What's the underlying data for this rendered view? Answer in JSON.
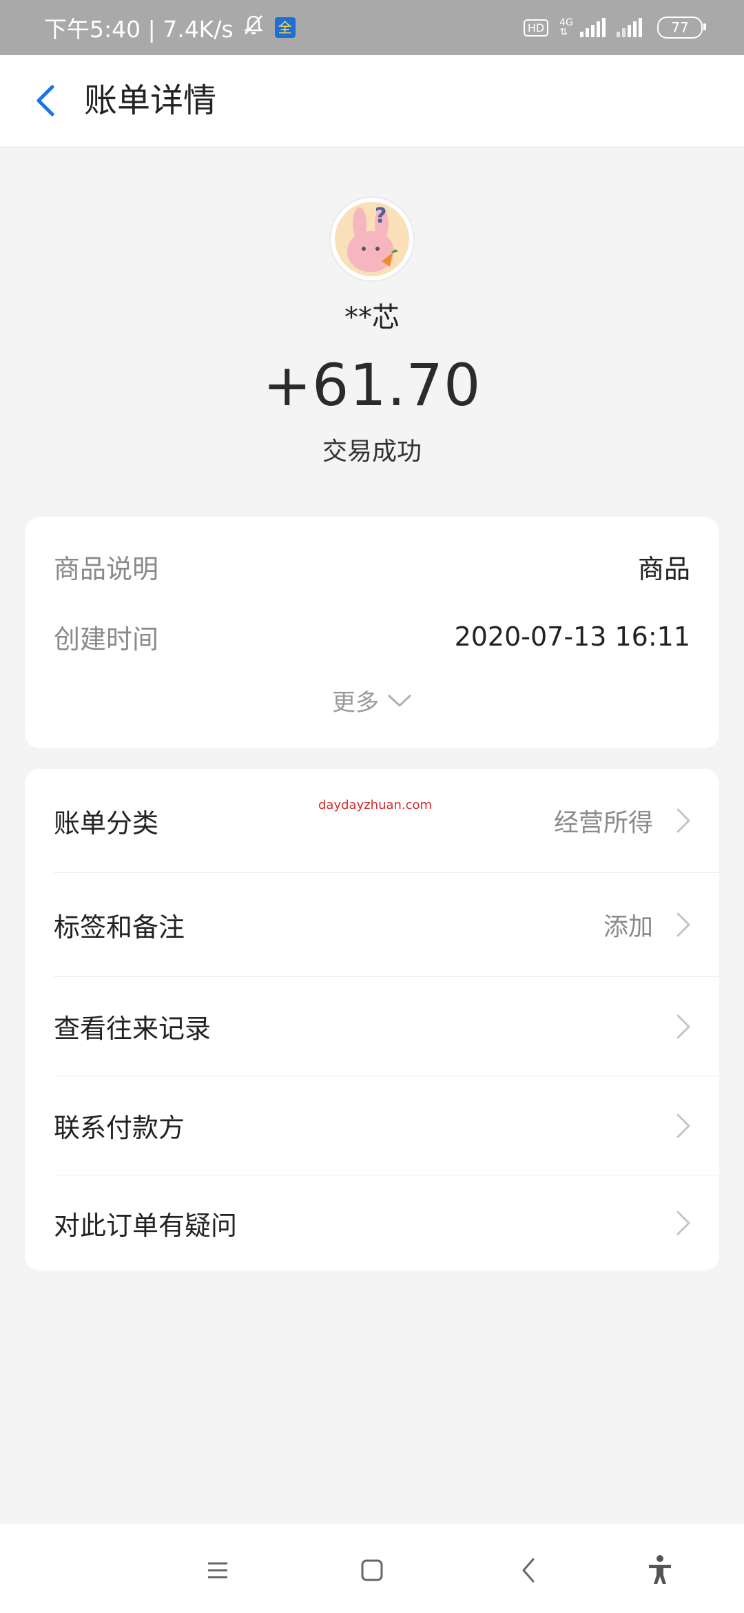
{
  "status_bar": {
    "time_speed": "下午5:40 | 7.4K/s",
    "mute_icon": "bell-off-icon",
    "app_badge": "全",
    "hd": "HD",
    "network": "4G",
    "battery": "77"
  },
  "header": {
    "back_icon": "chevron-left-icon",
    "title": "账单详情"
  },
  "transaction": {
    "name": "**芯",
    "amount": "+61.70",
    "status": "交易成功"
  },
  "details": {
    "rows": [
      {
        "label": "商品说明",
        "value": "商品"
      },
      {
        "label": "创建时间",
        "value": "2020-07-13 16:11"
      }
    ],
    "more": "更多"
  },
  "actions": {
    "items": [
      {
        "label": "账单分类",
        "value": "经营所得"
      },
      {
        "label": "标签和备注",
        "value": "添加"
      },
      {
        "label": "查看往来记录",
        "value": ""
      },
      {
        "label": "联系付款方",
        "value": ""
      },
      {
        "label": "对此订单有疑问",
        "value": ""
      }
    ]
  },
  "watermark": "daydayzhuan.com",
  "nav": {
    "icons": [
      "menu-icon",
      "home-icon",
      "back-icon",
      "accessibility-icon"
    ]
  },
  "colors": {
    "accent": "#1a73e8",
    "status_bar": "#a9a9a9",
    "background": "#f4f4f4",
    "watermark": "#d42a2a"
  }
}
